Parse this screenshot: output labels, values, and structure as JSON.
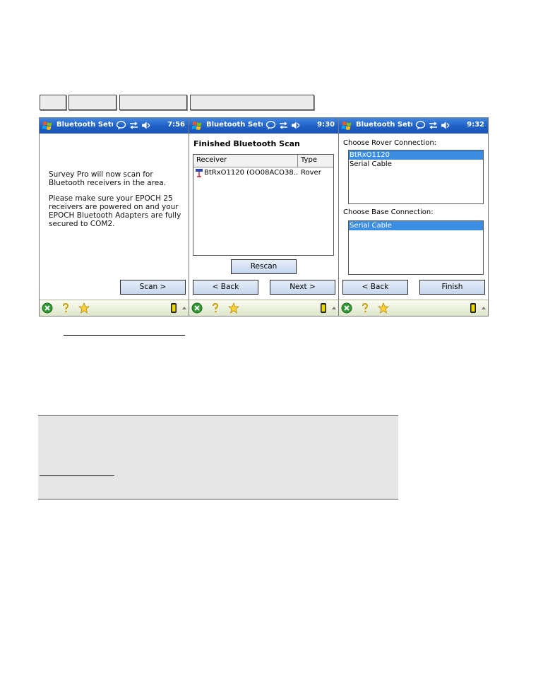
{
  "tabs": [
    {
      "label": ""
    },
    {
      "label": ""
    },
    {
      "label": ""
    },
    {
      "label": ""
    }
  ],
  "os": {
    "app_title": "Bluetooth Setu"
  },
  "icons": [
    "windows-logo-icon",
    "message-icon",
    "connectivity-icon",
    "volume-icon",
    "close-circle-icon",
    "help-icon",
    "favorites-icon",
    "battery-icon"
  ],
  "panel1": {
    "clock": "7:56",
    "intro_p1": "Survey Pro will now scan for Bluetooth receivers in the area.",
    "intro_p2": "Please make sure your EPOCH 25 receivers are powered on and your EPOCH Bluetooth Adapters are fully secured to COM2.",
    "scan_button": "Scan >"
  },
  "panel2": {
    "clock": "9:30",
    "heading": "Finished Bluetooth Scan",
    "columns": [
      "Receiver",
      "Type"
    ],
    "rows": [
      {
        "receiver": "BtRxO1120 (OO08ACO38...",
        "type": "Rover"
      }
    ],
    "rescan_button": "Rescan",
    "back_button": "< Back",
    "next_button": "Next >"
  },
  "panel3": {
    "clock": "9:32",
    "rover_label": "Choose Rover Connection:",
    "rover_options": [
      "BtRxO1120",
      "Serial Cable"
    ],
    "rover_selected": "BtRxO1120",
    "base_label": "Choose Base Connection:",
    "base_options": [
      "Serial Cable"
    ],
    "base_selected": "Serial Cable",
    "back_button": "< Back",
    "finish_button": "Finish"
  }
}
